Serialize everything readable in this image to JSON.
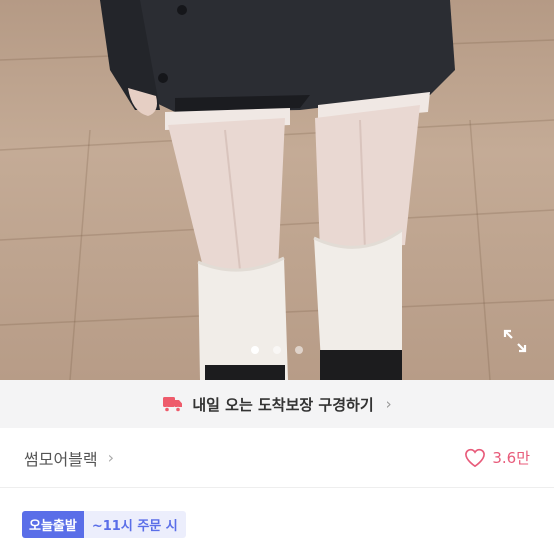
{
  "image": {
    "dots": [
      {
        "active": true
      },
      {
        "active": false
      },
      {
        "active": false
      }
    ]
  },
  "banner": {
    "text": "내일 오는 도착보장 구경하기",
    "icon": "delivery-truck-icon",
    "icon_color": "#ee5b6b"
  },
  "shop": {
    "name": "썸모어블랙",
    "likes": "3.6만"
  },
  "badges": {
    "main": "오늘출발",
    "sub": "~11시 주문 시"
  },
  "colors": {
    "accent": "#5a6ee8",
    "like": "#e85b7a"
  }
}
